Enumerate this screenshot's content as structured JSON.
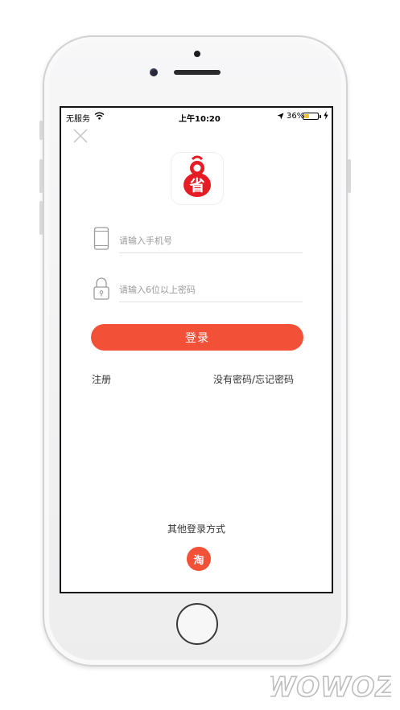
{
  "status_bar": {
    "carrier": "无服务",
    "time": "上午10:20",
    "battery_percent": "36%",
    "battery_level": 0.36
  },
  "login": {
    "phone_placeholder": "请输入手机号",
    "password_placeholder": "请输入6位以上密码",
    "login_button": "登录",
    "register_link": "注册",
    "forgot_link": "没有密码/忘记密码",
    "other_methods_label": "其他登录方式",
    "taobao_icon_text": "淘"
  },
  "app_logo": {
    "text": "省"
  },
  "watermark": {
    "text": "WOWOZ"
  },
  "colors": {
    "accent": "#f35038",
    "logo_red": "#e51c23",
    "battery_fill": "#f4c430"
  },
  "icons": [
    "wifi-icon",
    "location-arrow-icon",
    "battery-icon",
    "charging-icon",
    "close-icon",
    "phone-icon",
    "lock-icon"
  ]
}
